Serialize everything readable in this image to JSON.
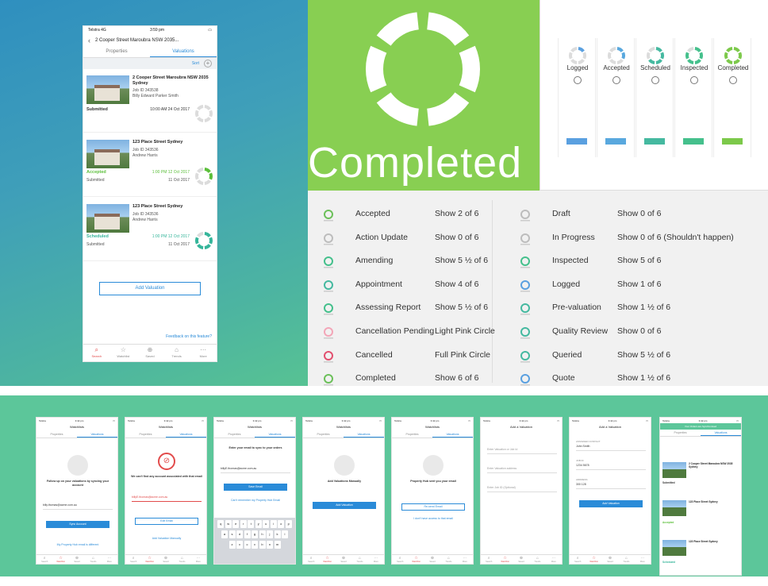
{
  "main_phone": {
    "status_carrier": "Telstra",
    "status_net": "4G",
    "status_time": "3:59 pm",
    "nav_title": "2 Cooper Street Maroubra NSW 2035...",
    "tabs": [
      "Properties",
      "Valuations"
    ],
    "sort_label": "Sort",
    "cards": [
      {
        "address": "2 Cooper Street Maroubra NSW 2035 Sydney",
        "job_id": "Job ID   343538",
        "agent": "Billy Edward Parker Smith",
        "status": "Submitted",
        "status_color": "#333333",
        "date": "10:00 AM 24 Oct 2017",
        "date_color": "#333333",
        "sub_status": "",
        "sub_date": "",
        "ring_color": "#cfcfcf",
        "ring_fill": 0
      },
      {
        "address": "123 Place Street Sydney",
        "job_id": "Job ID   343536",
        "agent": "Andrew Harris",
        "status": "Accepted",
        "status_color": "#5bbf3a",
        "date": "1:00 PM 12 Oct 2017",
        "date_color": "#5bbf3a",
        "sub_status": "Submitted",
        "sub_date": "11 Oct 2017",
        "ring_color": "#5bbf3a",
        "ring_fill": 2
      },
      {
        "address": "123 Place Street Sydney",
        "job_id": "Job ID   343536",
        "agent": "Andrew Harris",
        "status": "Scheduled",
        "status_color": "#35b59a",
        "date": "1:00 PM 12 Oct 2017",
        "date_color": "#35b59a",
        "sub_status": "Submitted",
        "sub_date": "11 Oct 2017",
        "ring_color": "#35b59a",
        "ring_fill": 5
      }
    ],
    "add_valuation": "Add Valuation",
    "feedback": "Feedback on this feature?",
    "tabbar": [
      {
        "label": "Search",
        "icon": "search-icon",
        "glyph": "⌕"
      },
      {
        "label": "Watchlist",
        "icon": "star-icon",
        "glyph": "☆"
      },
      {
        "label": "Saved",
        "icon": "saved-search-icon",
        "glyph": "⊕"
      },
      {
        "label": "Trends",
        "icon": "trends-icon",
        "glyph": "⌂"
      },
      {
        "label": "More",
        "icon": "more-icon",
        "glyph": "⋯"
      }
    ]
  },
  "completed_tile": {
    "word": "Completed",
    "color": "#88cf52"
  },
  "status_strip": {
    "columns": [
      {
        "label": "Logged",
        "color": "#5aa0e0",
        "fill": 1
      },
      {
        "label": "Accepted",
        "color": "#59a8de",
        "fill": 2
      },
      {
        "label": "Scheduled",
        "color": "#45b9a0",
        "fill": 4
      },
      {
        "label": "Inspected",
        "color": "#45c08c",
        "fill": 5
      },
      {
        "label": "Completed",
        "color": "#7cc94a",
        "fill": 6
      }
    ]
  },
  "legend": {
    "left": [
      {
        "name": "Accepted",
        "show": "Show 2 of 6"
      },
      {
        "name": "Action Update",
        "show": "Show 0 of 6"
      },
      {
        "name": "Amending",
        "show": "Show 5 ½ of 6"
      },
      {
        "name": "Appointment",
        "show": "Show 4 of 6"
      },
      {
        "name": "Assessing Report",
        "show": "Show 5 ½ of 6"
      },
      {
        "name": "Cancellation Pending",
        "show": "Light Pink Circle"
      },
      {
        "name": "Cancelled",
        "show": "Full Pink Circle"
      },
      {
        "name": "Completed",
        "show": "Show 6 of 6"
      }
    ],
    "right": [
      {
        "name": "Draft",
        "show": "Show 0 of 6"
      },
      {
        "name": "In Progress",
        "show": "Show 0 of 6 (Shouldn't happen)"
      },
      {
        "name": "Inspected",
        "show": "Show 5 of 6"
      },
      {
        "name": "Logged",
        "show": "Show 1 of 6"
      },
      {
        "name": "Pre-valuation",
        "show": "Show 1 ½ of 6"
      },
      {
        "name": "Quality Review",
        "show": "Show 0 of 6"
      },
      {
        "name": "Queried",
        "show": "Show 5 ½ of 6"
      },
      {
        "name": "Quote",
        "show": "Show 1 ½ of 6"
      }
    ],
    "mini_colors_left": [
      "#6cc05a",
      "#bdbdbd",
      "#45c08c",
      "#45b9a0",
      "#45c08c",
      "#f3a6b8",
      "#e2506f",
      "#6cc05a"
    ],
    "mini_colors_right": [
      "#bdbdbd",
      "#bdbdbd",
      "#45c08c",
      "#5aa0e0",
      "#45b9a0",
      "#45b9a0",
      "#45b9a0",
      "#5aa0e0"
    ]
  },
  "small_screens": {
    "status_carrier": "Telstra",
    "status_time": "3:42 pm",
    "watchlists": "Watchlists",
    "tabs": [
      "Properties",
      "Valuations"
    ],
    "s1": {
      "text": "Follow up on your valuations by syncing your account",
      "email": "billy.thomas@acme.com.au",
      "button": "Sync Account",
      "link": "My Property Hub email is different"
    },
    "s2": {
      "text": "We can't find any account associated with that email",
      "email": "billyE.thomas@acme.com.au",
      "button": "Edit Email",
      "link": "Add Valuation Manually"
    },
    "s3": {
      "text": "Enter your email to sync to your orders",
      "email": "billyE.thomas@acme.com.au",
      "button": "Save Email",
      "link": "Can't remember my Property Hub Email",
      "keys1": [
        "q",
        "w",
        "e",
        "r",
        "t",
        "y",
        "u",
        "i",
        "o",
        "p"
      ],
      "keys2": [
        "a",
        "s",
        "d",
        "f",
        "g",
        "h",
        "j",
        "k",
        "l"
      ],
      "keys3": [
        "z",
        "x",
        "c",
        "v",
        "b",
        "n",
        "m"
      ]
    },
    "s4": {
      "text": "Add Valuations Manually",
      "button": "Add Valuation"
    },
    "s5": {
      "text": "Property Hub sent you your email",
      "button": "Re-send Email",
      "link": "I don't have access to that email"
    },
    "s6": {
      "title": "Add a Valuation",
      "f1": "Enter Valuation or Job Id",
      "f2": "Enter Valuation address",
      "f3": "Enter Job ID (Optional)"
    },
    "s7": {
      "title": "Add a Valuation",
      "l1": "ASSIGNED CONTACT",
      "v1": "John Smith",
      "l2": "JOB ID",
      "v2": "1234 5678",
      "l3": "ADDRESS",
      "v3": "300 128",
      "button": "Add Valuation"
    },
    "s8": {
      "banner": "Your Orders are Synchronised",
      "addr": "2 Cooper Street Maroubra NSW 2035 Sydney",
      "a2": "123 Place Street Sydney",
      "st1": "Submitted",
      "st2": "Accepted",
      "st3": "Scheduled"
    },
    "tabbar": [
      "Search",
      "Watchlist",
      "Saved",
      "Trends",
      "More"
    ]
  }
}
